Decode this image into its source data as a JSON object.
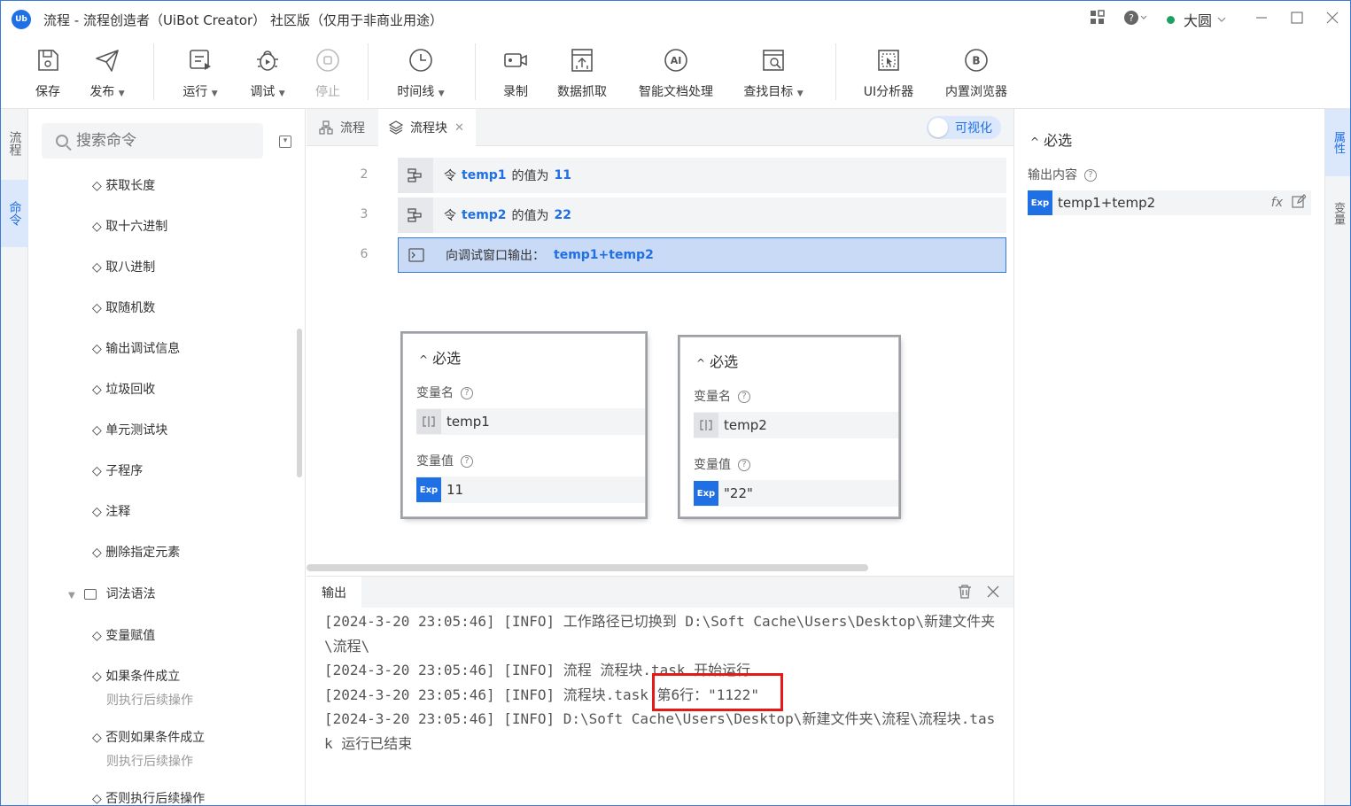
{
  "titlebar": {
    "app_logo": "Ub",
    "title": "流程 - 流程创造者（UiBot Creator） 社区版（仅用于非商业用途）",
    "user": "大圆",
    "icons": [
      "apps-icon",
      "help-icon",
      "minimize-icon",
      "maximize-icon",
      "close-icon"
    ]
  },
  "toolbar": [
    {
      "label": "保存",
      "icon": "save-icon"
    },
    {
      "label": "发布",
      "icon": "send-icon",
      "dropdown": true
    },
    {
      "label": "运行",
      "icon": "run-icon",
      "dropdown": true
    },
    {
      "label": "调试",
      "icon": "debug-icon",
      "dropdown": true
    },
    {
      "label": "停止",
      "icon": "stop-icon",
      "disabled": true
    },
    {
      "label": "时间线",
      "icon": "clock-icon",
      "dropdown": true
    },
    {
      "label": "录制",
      "icon": "record-icon"
    },
    {
      "label": "数据抓取",
      "icon": "data-grab-icon"
    },
    {
      "label": "智能文档处理",
      "icon": "ai-doc-icon"
    },
    {
      "label": "查找目标",
      "icon": "find-target-icon",
      "dropdown": true
    },
    {
      "label": "UI分析器",
      "icon": "ui-analyzer-icon"
    },
    {
      "label": "内置浏览器",
      "icon": "browser-icon"
    }
  ],
  "left_rail": {
    "tabs": [
      "流程",
      "命令"
    ],
    "active": "命令"
  },
  "commands": {
    "search_placeholder": "搜索命令",
    "items": [
      {
        "label": "获取长度"
      },
      {
        "label": "取十六进制"
      },
      {
        "label": "取八进制"
      },
      {
        "label": "取随机数"
      },
      {
        "label": "输出调试信息"
      },
      {
        "label": "垃圾回收"
      },
      {
        "label": "单元测试块"
      },
      {
        "label": "子程序"
      },
      {
        "label": "注释"
      },
      {
        "label": "删除指定元素"
      }
    ],
    "group": "词法语法",
    "group_items": [
      {
        "label": "变量赋值",
        "sub": ""
      },
      {
        "label": "如果条件成立",
        "sub": "则执行后续操作"
      },
      {
        "label": "否则如果条件成立",
        "sub": "则执行后续操作"
      },
      {
        "label": "否则执行后续操作",
        "sub": ""
      }
    ]
  },
  "tabs": [
    {
      "label": "流程",
      "icon": "flow-icon"
    },
    {
      "label": "流程块",
      "icon": "layers-icon",
      "active": true
    }
  ],
  "visual_toggle": "可视化",
  "code_rows": [
    {
      "num": "2",
      "icon": "assign-icon",
      "prefix": "令",
      "var": "temp1",
      "mid": "的值为",
      "value": "11"
    },
    {
      "num": "3",
      "icon": "assign-icon",
      "prefix": "令",
      "var": "temp2",
      "mid": "的值为",
      "value": "22"
    },
    {
      "num": "6",
      "icon": "terminal-icon",
      "text": "向调试窗口输出：",
      "value": "temp1+temp2",
      "selected": true
    }
  ],
  "popups": [
    {
      "header": "必选",
      "name_label": "变量名",
      "name": "temp1",
      "value_label": "变量值",
      "value": "11"
    },
    {
      "header": "必选",
      "name_label": "变量名",
      "name": "temp2",
      "value_label": "变量值",
      "value": "\"22\""
    }
  ],
  "output": {
    "tab": "输出",
    "lines": [
      "[2024-3-20 23:05:46] [INFO] 工作路径已切换到 D:\\Soft Cache\\Users\\Desktop\\新建文件夹\\流程\\",
      "[2024-3-20 23:05:46] [INFO] 流程 流程块.task 开始运行",
      "[2024-3-20 23:05:46] [INFO] 流程块.task 第6行：\"1122\"",
      "[2024-3-20 23:05:46] [INFO] D:\\Soft Cache\\Users\\Desktop\\新建文件夹\\流程\\流程块.task 运行已结束"
    ],
    "highlight_color": "#e81818"
  },
  "properties": {
    "header": "必选",
    "label": "输出内容",
    "value": "temp1+temp2"
  },
  "right_rail": {
    "tabs": [
      "属性",
      "变量"
    ],
    "active": "属性"
  },
  "colors": {
    "accent": "#1f6fe5",
    "selected_row": "#c9daf7",
    "online": "#1aa260"
  }
}
